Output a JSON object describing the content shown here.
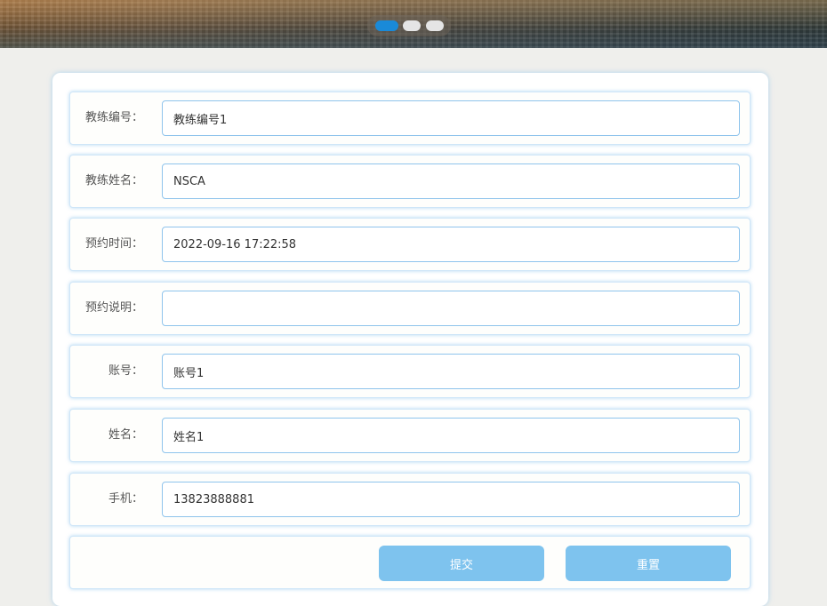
{
  "banner": {
    "carousel_count": 3,
    "carousel_active_index": 0
  },
  "form": {
    "fields": [
      {
        "label": "教练编号：",
        "value": "教练编号1",
        "placeholder": ""
      },
      {
        "label": "教练姓名：",
        "value": "NSCA",
        "placeholder": ""
      },
      {
        "label": "预约时间：",
        "value": "2022-09-16 17:22:58",
        "placeholder": ""
      },
      {
        "label": "预约说明：",
        "value": "",
        "placeholder": ""
      },
      {
        "label": "账号：",
        "value": "账号1",
        "placeholder": ""
      },
      {
        "label": "姓名：",
        "value": "姓名1",
        "placeholder": ""
      },
      {
        "label": "手机：",
        "value": "13823888881",
        "placeholder": ""
      }
    ],
    "submit_label": "提交",
    "reset_label": "重置"
  },
  "colors": {
    "accent": "#1a8ad8",
    "button": "#7ec3ee",
    "input_border": "#8fc4ec",
    "background": "#efefec"
  }
}
